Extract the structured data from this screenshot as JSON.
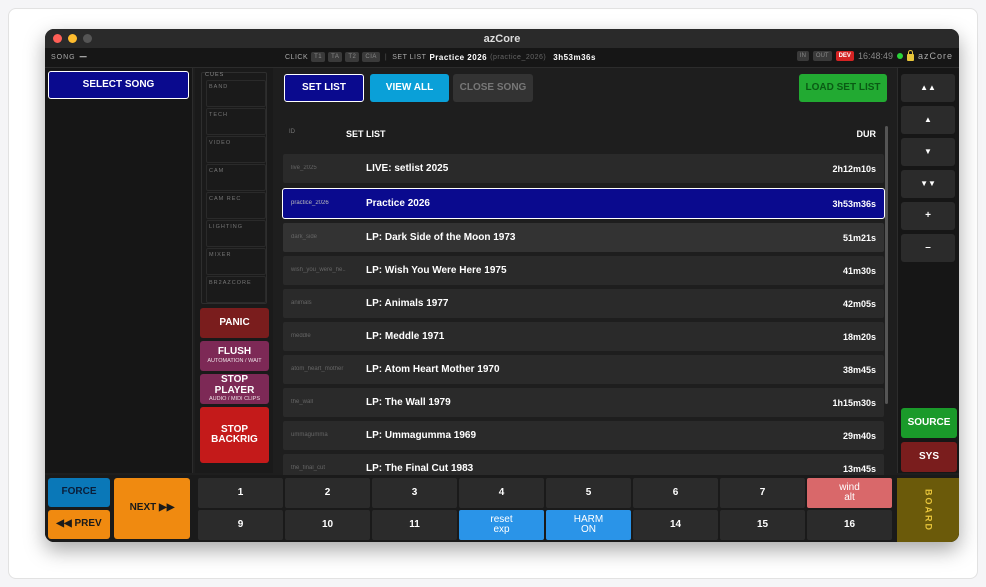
{
  "app": {
    "title": "azCore"
  },
  "status": {
    "song_label": "SONG",
    "song_value": "—",
    "click_label": "CLICK",
    "click_chips": [
      "T1",
      "TA",
      "T2",
      "CIA"
    ],
    "setlist_label": "SET LIST",
    "setlist_name": "Practice 2026",
    "setlist_id": "(practice_2026)",
    "setlist_dur": "3h53m36s",
    "in_label": "IN",
    "out_label": "OUT",
    "dev_label": "DEV",
    "time": "16:48:49",
    "app_name": "azCore"
  },
  "left": {
    "select_song": "SELECT SONG"
  },
  "cues": {
    "title": "CUES",
    "items": [
      "BAND",
      "TECH",
      "VIDEO",
      "CAM",
      "CAM REC",
      "LIGHTING",
      "MIXER",
      "BR2AZCORE"
    ]
  },
  "actions": {
    "panic": "PANIC",
    "flush": "FLUSH",
    "flush_sub": "AUTOMATION / WAIT",
    "stop_player": "STOP PLAYER",
    "stop_player_sub": "AUDIO / MIDI CLIPS",
    "stop_backrig_1": "STOP",
    "stop_backrig_2": "BACKRIG"
  },
  "toolbar": {
    "set_list": "SET LIST",
    "view_all": "VIEW ALL",
    "close_song": "CLOSE SONG",
    "load_set_list": "LOAD SET LIST"
  },
  "table": {
    "col_id": "ID",
    "col_title": "SET LIST",
    "col_dur": "DUR",
    "rows": [
      {
        "id": "live_2025",
        "name": "LIVE: setlist 2025",
        "dur": "2h12m10s"
      },
      {
        "id": "practice_2026",
        "name": "Practice 2026",
        "dur": "3h53m36s"
      },
      {
        "id": "dark_side",
        "name": "LP: Dark Side of the Moon 1973",
        "dur": "51m21s"
      },
      {
        "id": "wish_you_were_he...",
        "name": "LP: Wish You Were Here 1975",
        "dur": "41m30s"
      },
      {
        "id": "animals",
        "name": "LP: Animals 1977",
        "dur": "42m05s"
      },
      {
        "id": "meddle",
        "name": "LP: Meddle 1971",
        "dur": "18m20s"
      },
      {
        "id": "atom_heart_mother",
        "name": "LP: Atom Heart Mother 1970",
        "dur": "38m45s"
      },
      {
        "id": "the_wall",
        "name": "LP: The Wall 1979",
        "dur": "1h15m30s"
      },
      {
        "id": "ummagumma",
        "name": "LP: Ummagumma 1969",
        "dur": "29m40s"
      },
      {
        "id": "the_final_cut",
        "name": "LP: The Final Cut 1983",
        "dur": "13m45s"
      }
    ]
  },
  "nav": {
    "top": "▲▲",
    "up": "▲",
    "down": "▼",
    "bottom": "▼▼",
    "plus": "+",
    "minus": "–",
    "source": "SOURCE",
    "sys": "SYS"
  },
  "transport": {
    "force": "FORCE",
    "next": "NEXT ▶▶",
    "prev": "◀◀ PREV",
    "board": "BOARD"
  },
  "pads_top": [
    "1",
    "2",
    "3",
    "4",
    "5",
    "6",
    "7"
  ],
  "pad_wind_1": "wind",
  "pad_wind_2": "alt",
  "pads_bottom": [
    "9",
    "10",
    "11"
  ],
  "pad_reset_1": "reset",
  "pad_reset_2": "exp",
  "pad_harm_1": "HARM",
  "pad_harm_2": "ON",
  "pads_bottom2": [
    "14",
    "15",
    "16"
  ]
}
